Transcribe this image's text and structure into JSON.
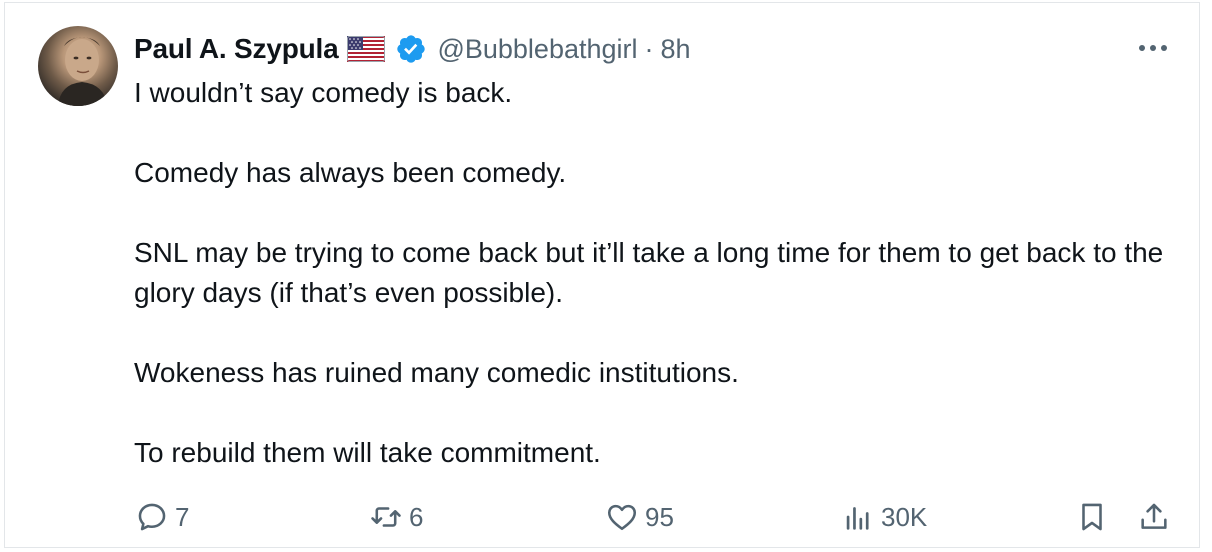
{
  "tweet": {
    "author_name": "Paul A. Szypula",
    "flag_icon": "us-flag-icon",
    "verified_icon": "verified-badge-icon",
    "handle": "@Bubblebathgirl",
    "separator": "·",
    "time": "8h",
    "paragraphs": [
      "I wouldn’t say comedy is back.",
      "Comedy has always been comedy.",
      "SNL may be trying to come back but it’ll take a long time for them to get back to the glory days (if that’s even possible).",
      "Wokeness has ruined many comedic institutions.",
      "To rebuild them will take commitment."
    ]
  },
  "actions": {
    "replies": "7",
    "retweets": "6",
    "likes": "95",
    "views": "30K"
  },
  "colors": {
    "text": "#0f1419",
    "secondary": "#536471",
    "verified": "#1d9bf0",
    "border": "#e3e6e9"
  }
}
